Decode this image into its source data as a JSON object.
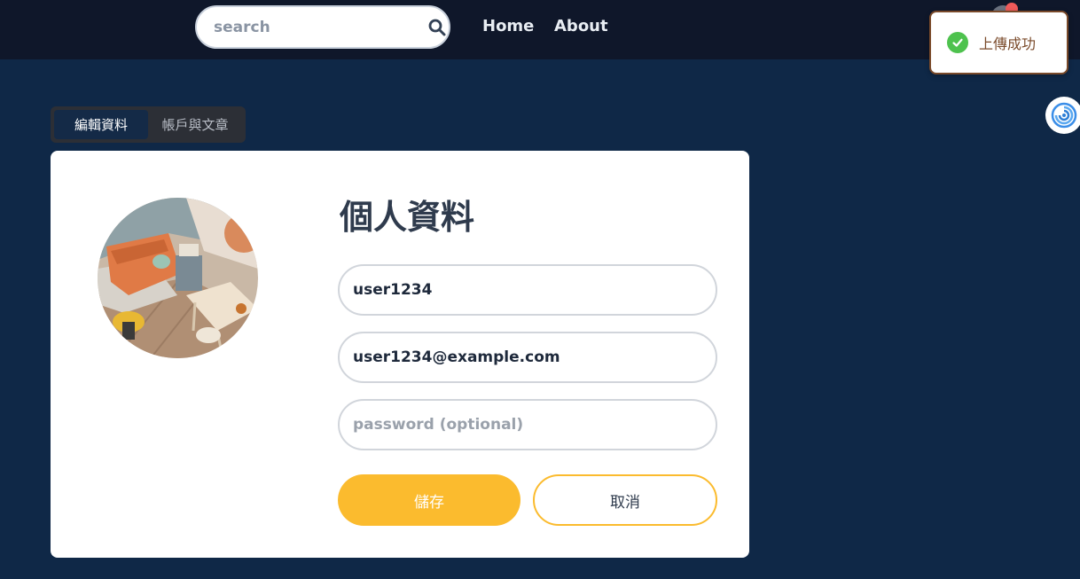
{
  "nav": {
    "search_placeholder": "search",
    "links": [
      {
        "label": "Home"
      },
      {
        "label": "About"
      }
    ]
  },
  "toast": {
    "message": "上傳成功",
    "status_color": "#4ec24e"
  },
  "tabs": [
    {
      "label": "編輯資料",
      "active": true
    },
    {
      "label": "帳戶與文章",
      "active": false
    }
  ],
  "profile": {
    "title": "個人資料",
    "username": "user1234",
    "email": "user1234@example.com",
    "password_placeholder": "password (optional)",
    "save_label": "儲存",
    "cancel_label": "取消"
  },
  "colors": {
    "page_bg": "#0f2847",
    "topbar_bg": "#0f172a",
    "accent": "#fbbb2e"
  }
}
